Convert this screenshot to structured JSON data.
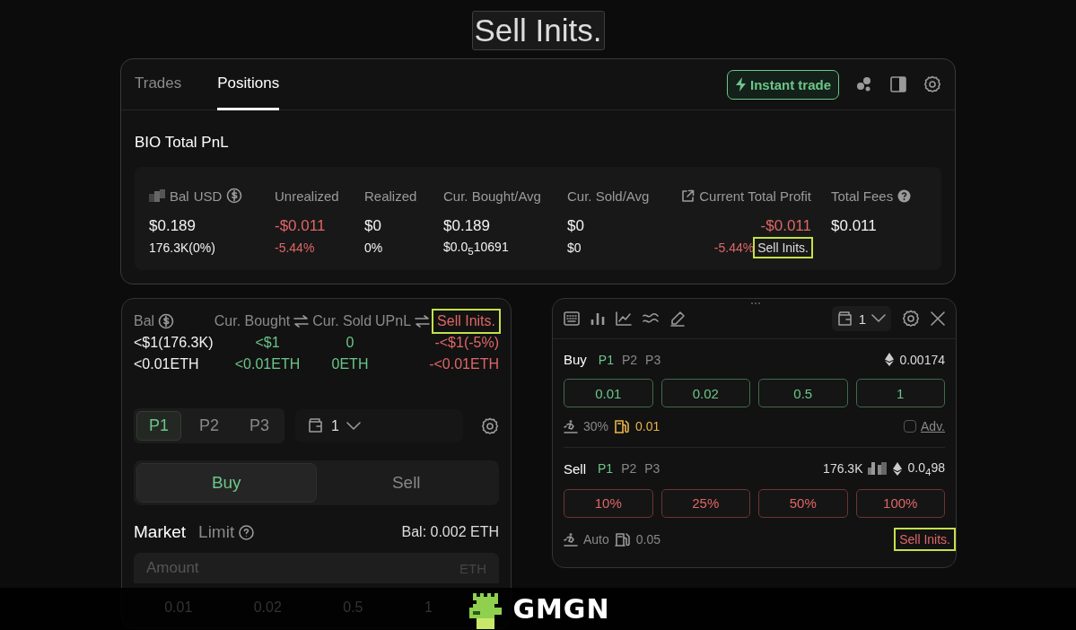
{
  "title": "Sell Inits.",
  "tabs": [
    {
      "label": "Trades",
      "selected": false
    },
    {
      "label": "Positions",
      "selected": true
    }
  ],
  "instant_trade": "Instant trade",
  "pnl": {
    "title": "BIO Total PnL",
    "columns": [
      {
        "label": "Bal",
        "unit": "USD",
        "value": "$0.189",
        "sub": "176.3K(0%)",
        "color": "#f2f2f2"
      },
      {
        "label": "Unrealized",
        "value": "-$0.011",
        "sub": "-5.44%",
        "color": "#e06666"
      },
      {
        "label": "Realized",
        "value": "$0",
        "sub": "0%",
        "color": "#f2f2f2"
      },
      {
        "label": "Cur. Bought/Avg",
        "value": "$0.189",
        "sub": "$0.0$_{5}$10691",
        "color": "#f2f2f2"
      },
      {
        "label": "Cur. Sold/Avg",
        "value": "$0",
        "sub": "$0",
        "color": "#f2f2f2"
      },
      {
        "label": "Current Total Profit",
        "value": "-$0.011",
        "sub": "-5.44%",
        "color": "#e06666",
        "action": {
          "label": "Sell Inits.",
          "highlighted": true
        }
      },
      {
        "label": "Total Fees",
        "value": "$0.011",
        "color": "#f2f2f2"
      }
    ]
  },
  "left": {
    "columns": [
      {
        "header": "Bal",
        "color": "#f2f2f2"
      },
      {
        "header": "Cur. Bought",
        "color": "#6cc58a"
      },
      {
        "header": "Cur. Sold",
        "color": "#6cc58a"
      },
      {
        "header": "UPnL",
        "color": "#e06666"
      }
    ],
    "sell_action": {
      "label": "Sell Inits.",
      "highlighted": true
    },
    "rows": [
      [
        "<$1(176.3K)",
        "<$1",
        "0",
        "-<$1(-5%)"
      ],
      [
        "<0.01ETH",
        "<0.01ETH",
        "0ETH",
        "-<0.01ETH"
      ]
    ],
    "presets": [
      {
        "label": "P1",
        "selected": true
      },
      {
        "label": "P2",
        "selected": false
      },
      {
        "label": "P3",
        "selected": false
      }
    ],
    "wallet": "1",
    "sides": [
      {
        "label": "Buy",
        "selected": true
      },
      {
        "label": "Sell",
        "selected": false
      }
    ],
    "order_types": [
      {
        "label": "Market",
        "selected": true
      },
      {
        "label": "Limit",
        "selected": false
      }
    ],
    "balance": "Bal: 0.002 ETH",
    "amount": {
      "placeholder": "Amount",
      "unit": "ETH"
    },
    "quick_amounts": [
      "0.01",
      "0.02",
      "0.5",
      "1"
    ]
  },
  "right": {
    "wallet": "1",
    "sections": [
      {
        "kind": "buy",
        "label": "Buy",
        "presets": [
          {
            "label": "P1",
            "selected": true
          },
          {
            "label": "P2",
            "selected": false
          },
          {
            "label": "P3",
            "selected": false
          }
        ],
        "balance": "0.00174",
        "buttons": [
          "0.01",
          "0.02",
          "0.5",
          "1"
        ],
        "slippage": "30%",
        "gas": "0.01",
        "gas_warning": true,
        "adv": {
          "label": "Adv.",
          "checked": false
        }
      },
      {
        "kind": "sell",
        "label": "Sell",
        "presets": [
          {
            "label": "P1",
            "selected": true
          },
          {
            "label": "P2",
            "selected": false
          },
          {
            "label": "P3",
            "selected": false
          }
        ],
        "holding": "176.3K",
        "balance": "0.0$_{4}$98",
        "buttons": [
          "10%",
          "25%",
          "50%",
          "100%"
        ],
        "slippage": "Auto",
        "gas": "0.05",
        "gas_warning": false,
        "action": {
          "label": "Sell Inits.",
          "highlighted": true
        }
      }
    ]
  },
  "brand": "GMGN"
}
